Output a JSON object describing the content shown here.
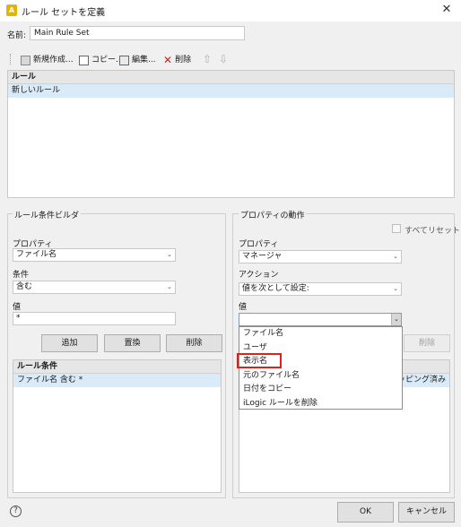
{
  "window": {
    "title": "ルール セットを定義",
    "close_glyph": "✕",
    "icon_glyph": "A"
  },
  "name_field": {
    "label": "名前:",
    "value": "Main Rule Set"
  },
  "toolbar": {
    "new_label": "新規作成...",
    "copy_label": "コピー...",
    "edit_label": "編集...",
    "delete_label": "削除",
    "up_glyph": "⇧",
    "down_glyph": "⇩"
  },
  "rules_list": {
    "header": "ルール",
    "items": [
      "新しいルール"
    ]
  },
  "rule_builder": {
    "title": "ルール条件ビルダ",
    "property_label": "プロパティ",
    "property_value": "ファイル名",
    "condition_label": "条件",
    "condition_value": "含む",
    "value_label": "値",
    "value_value": "*",
    "add_button": "追加",
    "replace_button": "置換",
    "delete_button": "削除",
    "conditions_header": "ルール条件",
    "conditions": [
      "ファイル名 含む *"
    ]
  },
  "property_action": {
    "title": "プロパティの動作",
    "reset_all_label": "すべてリセット",
    "property_label": "プロパティ",
    "property_value": "マネージャ",
    "action_label": "アクション",
    "action_value": "値を次として設定:",
    "value_label": "値",
    "value_value": "",
    "delete_button": "削除",
    "partial_cell": "ッピング済み"
  },
  "dropdown": {
    "items": [
      "ファイル名",
      "ユーザ",
      "表示名",
      "元のファイル名",
      "日付をコピー",
      "iLogic ルールを削除"
    ],
    "highlighted_index": 2
  },
  "footer": {
    "help_glyph": "?",
    "ok_label": "OK",
    "cancel_label": "キャンセル"
  },
  "icons": {
    "combo_arrow": "⌄"
  }
}
